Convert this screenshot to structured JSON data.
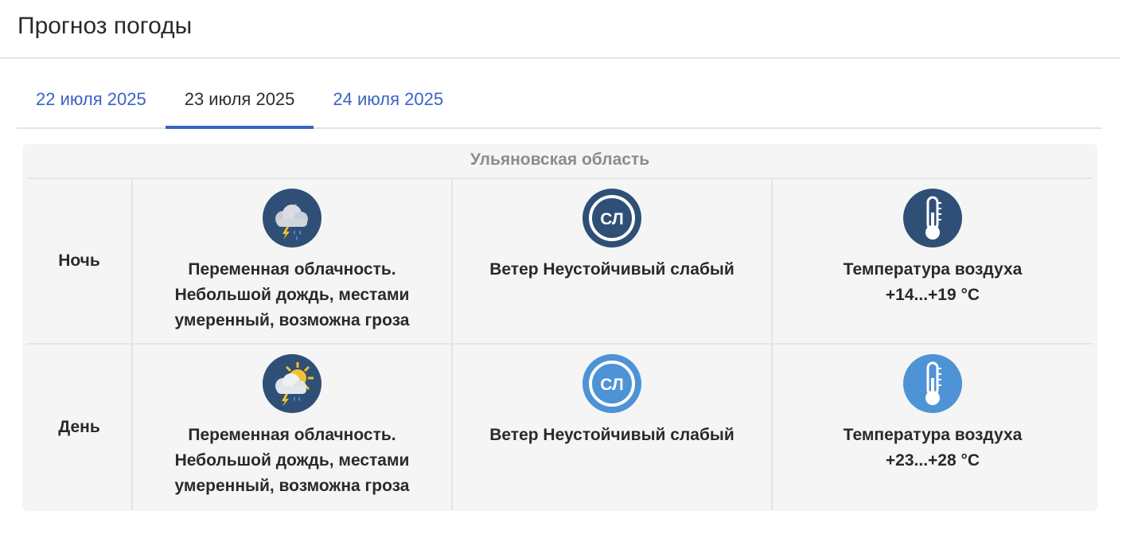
{
  "page": {
    "title": "Прогноз погоды"
  },
  "tabs": [
    {
      "label": "22 июля 2025",
      "active": false
    },
    {
      "label": "23 июля 2025",
      "active": true
    },
    {
      "label": "24 июля 2025",
      "active": false
    }
  ],
  "forecast": {
    "region": "Ульяновская область",
    "rows": [
      {
        "label": "Ночь",
        "theme": "dark",
        "condition_icon": "night-cloud-rain-thunder-icon",
        "condition": "Переменная облачность. Небольшой дождь, местами умеренный, возможна гроза",
        "wind_icon_text": "СЛ",
        "wind": "Ветер Неустойчивый слабый",
        "temperature_icon": "thermometer-icon",
        "temperature_label": "Температура воздуха",
        "temperature": "+14...+19 °C"
      },
      {
        "label": "День",
        "theme": "light",
        "condition_icon": "sun-cloud-rain-thunder-icon",
        "condition": "Переменная облачность. Небольшой дождь, местами умеренный, возможна гроза",
        "wind_icon_text": "СЛ",
        "wind": "Ветер Неустойчивый слабый",
        "temperature_icon": "thermometer-icon",
        "temperature_label": "Температура воздуха",
        "temperature": "+23...+28 °C"
      }
    ]
  },
  "colors": {
    "accent": "#3b63c4",
    "night_icon_bg": "#2f4f76",
    "day_icon_bg": "#4d93d6",
    "card_bg": "#f5f5f5"
  }
}
